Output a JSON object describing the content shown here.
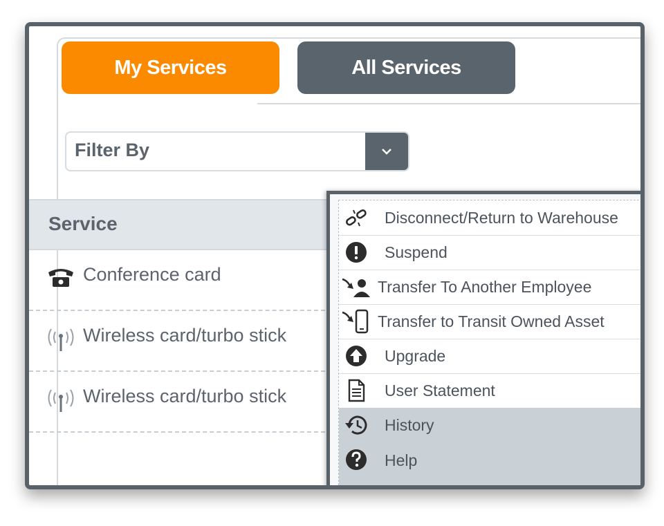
{
  "tabs": [
    {
      "label": "My Services",
      "active": true
    },
    {
      "label": "All Services",
      "active": false
    }
  ],
  "filter": {
    "value": "Filter By",
    "icon": "chevron-down-icon"
  },
  "table": {
    "header": "Service",
    "rows": [
      {
        "label": "Conference card",
        "icon": "phone-icon"
      },
      {
        "label": "Wireless card/turbo stick",
        "icon": "antenna-icon"
      },
      {
        "label": "Wireless card/turbo stick",
        "icon": "antenna-icon"
      }
    ]
  },
  "menu": {
    "items": [
      {
        "label": "Disconnect/Return to Warehouse",
        "icon": "broken-link-icon"
      },
      {
        "label": "Suspend",
        "icon": "exclamation-icon"
      },
      {
        "label": "Transfer To Another Employee",
        "icon": "transfer-user-icon"
      },
      {
        "label": "Transfer to Transit Owned Asset",
        "icon": "transfer-device-icon"
      },
      {
        "label": "Upgrade",
        "icon": "upgrade-arrow-icon"
      },
      {
        "label": "User Statement",
        "icon": "document-icon"
      },
      {
        "label": "History",
        "icon": "history-icon",
        "highlighted": true
      },
      {
        "label": "Help",
        "icon": "question-icon",
        "highlighted": true
      }
    ]
  },
  "colors": {
    "accent": "#fb8a00",
    "dark": "#5a646c",
    "highlight": "#c9d1d7"
  }
}
